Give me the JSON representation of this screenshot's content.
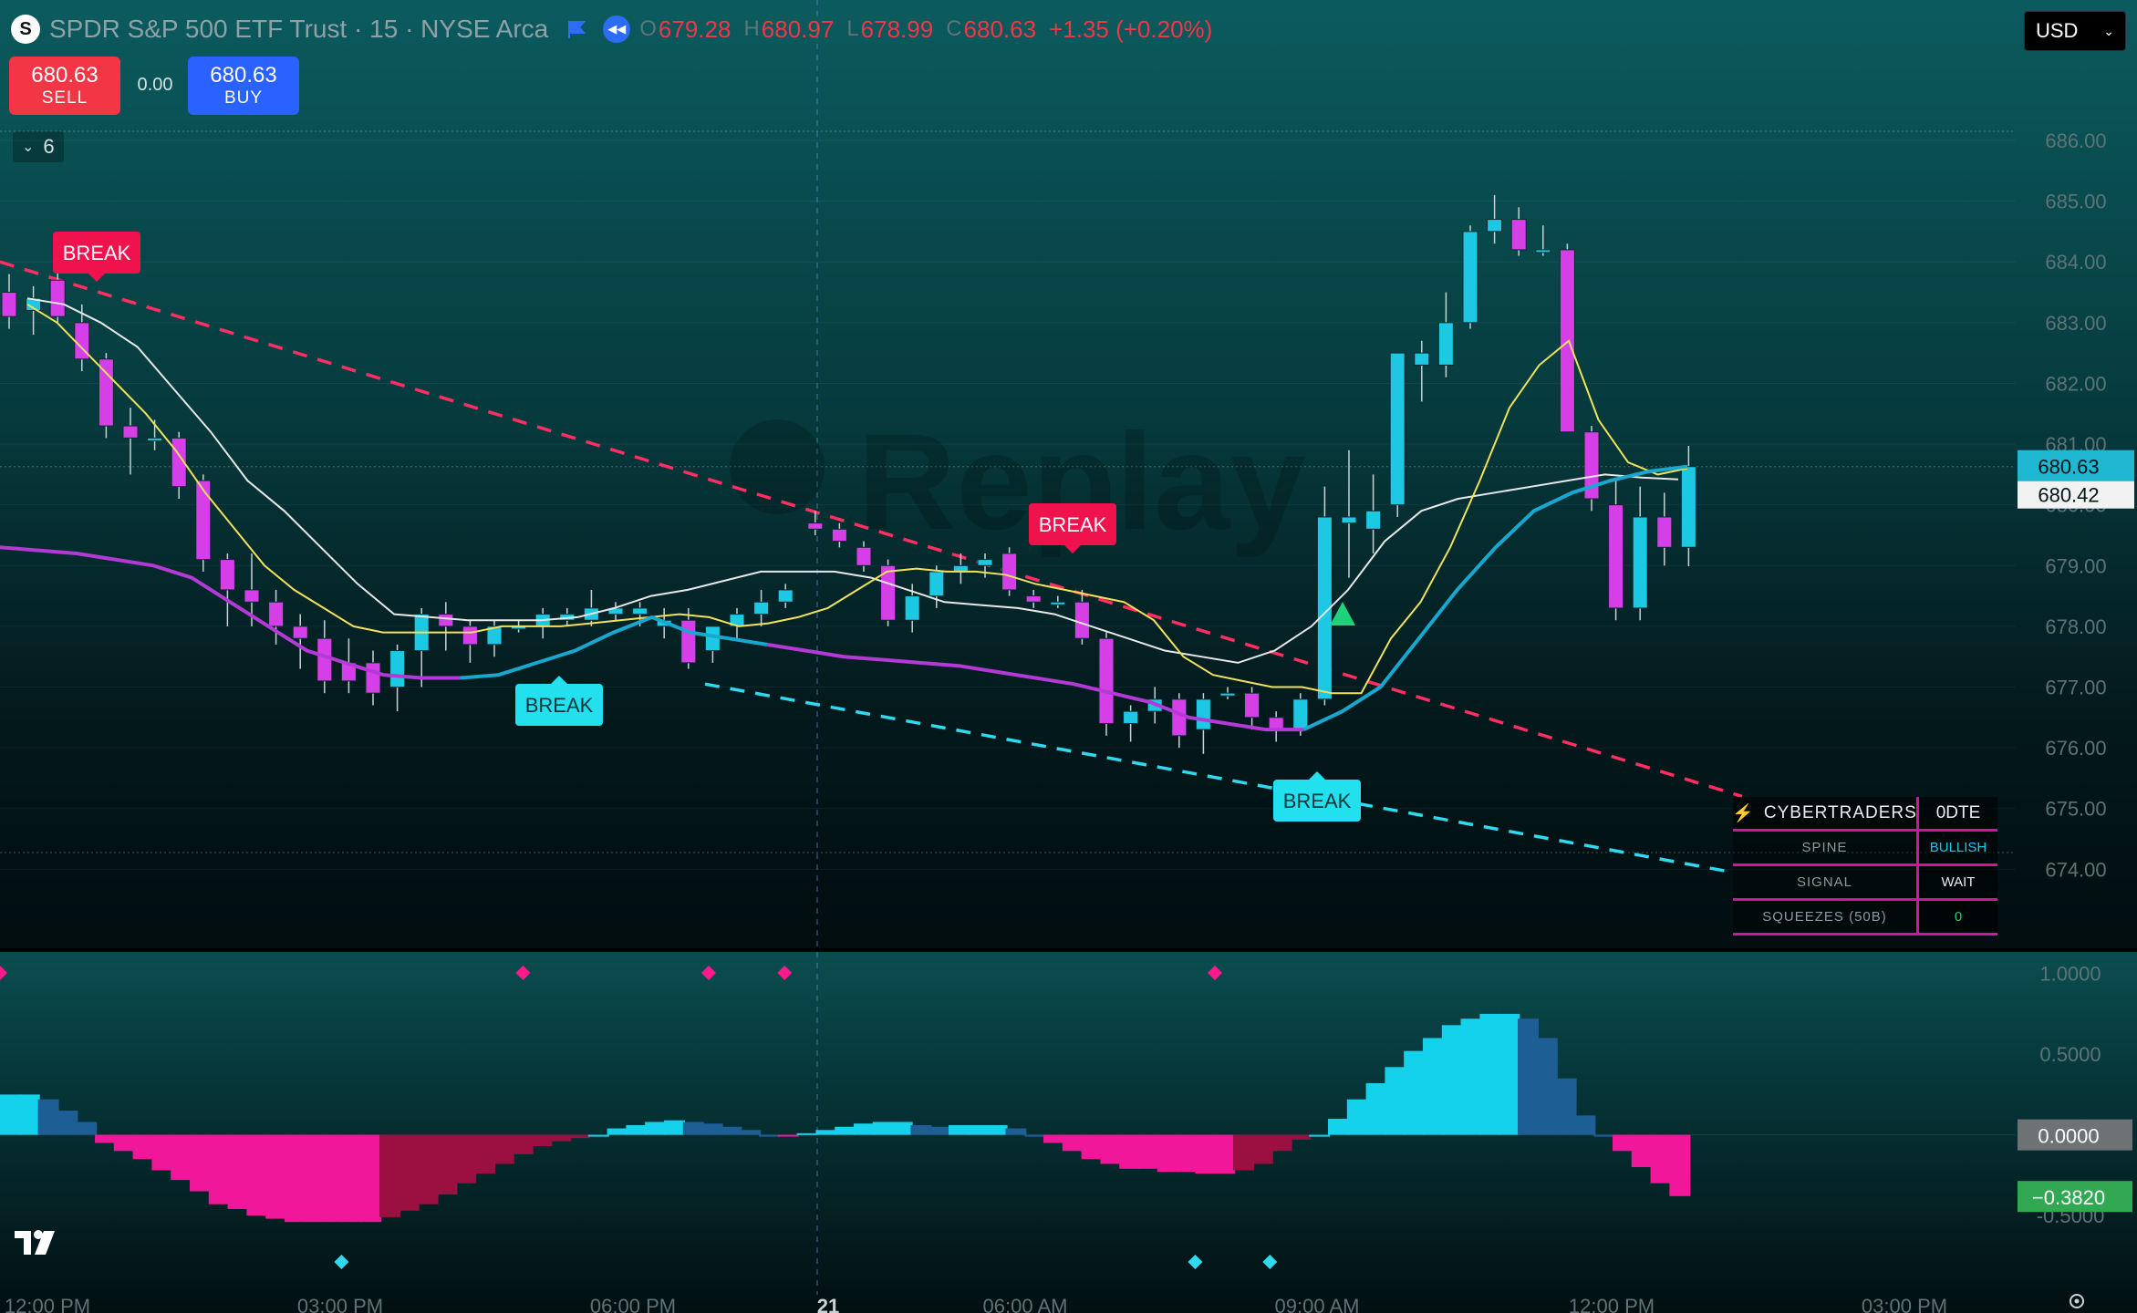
{
  "header": {
    "symbol_logo": "S",
    "name": "SPDR S&P 500 ETF Trust · 15 · NYSE Arca",
    "ohlc": [
      {
        "label": "O",
        "value": "679.28"
      },
      {
        "label": "H",
        "value": "680.97"
      },
      {
        "label": "L",
        "value": "678.99"
      },
      {
        "label": "C",
        "value": "680.63"
      }
    ],
    "change": "+1.35 (+0.20%)"
  },
  "trade": {
    "sell_price": "680.63",
    "sell_label": "SELL",
    "spread": "0.00",
    "buy_price": "680.63",
    "buy_label": "BUY"
  },
  "indicators_collapse": {
    "count": "6"
  },
  "currency": "USD",
  "watermark": "Replay",
  "colors": {
    "bull": "#1cc8e2",
    "bear": "#d63fe8",
    "fast_ma": "#f0e25a",
    "slow_ma": "#e8e8e8",
    "spine_up": "#18a8cf",
    "spine_down": "#b43ad6",
    "resistance": "#ff2e63",
    "support": "#2fd9ef",
    "hist_bull": "#14d2ec",
    "hist_bull_fade": "#1d5f94",
    "hist_bear": "#f0179b",
    "hist_bear_fade": "#9b1040"
  },
  "price_axis": {
    "ticks": [
      "686.00",
      "685.00",
      "684.00",
      "683.00",
      "682.00",
      "681.00",
      "680.00",
      "679.00",
      "678.00",
      "677.00",
      "676.00",
      "675.00",
      "674.00"
    ],
    "last_price": "680.63",
    "slow_ma_value": "680.42"
  },
  "osc_axis": {
    "ticks": [
      "1.0000",
      "0.5000",
      "0.0000",
      "-0.5000"
    ],
    "zero_label": "0.0000",
    "current_label": "−0.3820"
  },
  "time_axis": [
    "12:00 PM",
    "03:00 PM",
    "06:00 PM",
    "21",
    "06:00 AM",
    "09:00 AM",
    "12:00 PM",
    "03:00 PM"
  ],
  "labels": {
    "break": "BREAK"
  },
  "cybertraders": {
    "title": "CYBERTRADERS",
    "title_icon": "lightning-icon",
    "mode": "0DTE",
    "rows": [
      {
        "label": "SPINE",
        "value": "BULLISH"
      },
      {
        "label": "SIGNAL",
        "value": "WAIT"
      },
      {
        "label": "SQUEEZES (50B)",
        "value": "0"
      }
    ]
  },
  "chart_data": {
    "type": "candlestick",
    "symbol": "SPY",
    "interval": "15",
    "ylim": [
      673.6,
      686.3
    ],
    "candles": [
      {
        "o": 683.5,
        "h": 683.8,
        "l": 682.9,
        "c": 683.1
      },
      {
        "o": 683.2,
        "h": 683.6,
        "l": 682.8,
        "c": 683.4
      },
      {
        "o": 683.7,
        "h": 683.9,
        "l": 683.0,
        "c": 683.1
      },
      {
        "o": 683.0,
        "h": 683.3,
        "l": 682.2,
        "c": 682.4
      },
      {
        "o": 682.4,
        "h": 682.5,
        "l": 681.1,
        "c": 681.3
      },
      {
        "o": 681.3,
        "h": 681.6,
        "l": 680.5,
        "c": 681.1
      },
      {
        "o": 681.1,
        "h": 681.4,
        "l": 680.9,
        "c": 681.1
      },
      {
        "o": 681.1,
        "h": 681.2,
        "l": 680.1,
        "c": 680.3
      },
      {
        "o": 680.4,
        "h": 680.5,
        "l": 678.9,
        "c": 679.1
      },
      {
        "o": 679.1,
        "h": 679.2,
        "l": 678.0,
        "c": 678.6
      },
      {
        "o": 678.6,
        "h": 679.2,
        "l": 678.0,
        "c": 678.4
      },
      {
        "o": 678.4,
        "h": 678.6,
        "l": 677.7,
        "c": 678.0
      },
      {
        "o": 678.0,
        "h": 678.2,
        "l": 677.3,
        "c": 677.8
      },
      {
        "o": 677.8,
        "h": 678.1,
        "l": 676.9,
        "c": 677.1
      },
      {
        "o": 677.4,
        "h": 677.8,
        "l": 676.9,
        "c": 677.1
      },
      {
        "o": 677.4,
        "h": 677.6,
        "l": 676.7,
        "c": 676.9
      },
      {
        "o": 677.0,
        "h": 677.7,
        "l": 676.6,
        "c": 677.6
      },
      {
        "o": 677.6,
        "h": 678.3,
        "l": 677.0,
        "c": 678.2
      },
      {
        "o": 678.2,
        "h": 678.4,
        "l": 677.6,
        "c": 678.0
      },
      {
        "o": 678.0,
        "h": 678.1,
        "l": 677.4,
        "c": 677.7
      },
      {
        "o": 677.7,
        "h": 678.1,
        "l": 677.5,
        "c": 678.0
      },
      {
        "o": 678.0,
        "h": 678.1,
        "l": 677.9,
        "c": 678.0
      },
      {
        "o": 678.0,
        "h": 678.3,
        "l": 677.8,
        "c": 678.2
      },
      {
        "o": 678.1,
        "h": 678.3,
        "l": 678.0,
        "c": 678.2
      },
      {
        "o": 678.1,
        "h": 678.6,
        "l": 678.0,
        "c": 678.3
      },
      {
        "o": 678.2,
        "h": 678.4,
        "l": 678.1,
        "c": 678.3
      },
      {
        "o": 678.2,
        "h": 678.4,
        "l": 678.0,
        "c": 678.3
      },
      {
        "o": 678.0,
        "h": 678.3,
        "l": 677.8,
        "c": 678.1
      },
      {
        "o": 678.1,
        "h": 678.3,
        "l": 677.3,
        "c": 677.4
      },
      {
        "o": 677.6,
        "h": 678.0,
        "l": 677.4,
        "c": 678.0
      },
      {
        "o": 678.0,
        "h": 678.3,
        "l": 677.8,
        "c": 678.2
      },
      {
        "o": 678.2,
        "h": 678.6,
        "l": 678.0,
        "c": 678.4
      },
      {
        "o": 678.4,
        "h": 678.7,
        "l": 678.3,
        "c": 678.6
      },
      {
        "o": 679.7,
        "h": 679.9,
        "l": 679.5,
        "c": 679.6
      },
      {
        "o": 679.6,
        "h": 679.7,
        "l": 679.3,
        "c": 679.4
      },
      {
        "o": 679.3,
        "h": 679.4,
        "l": 678.9,
        "c": 679.0
      },
      {
        "o": 679.0,
        "h": 679.1,
        "l": 678.0,
        "c": 678.1
      },
      {
        "o": 678.1,
        "h": 678.7,
        "l": 677.9,
        "c": 678.5
      },
      {
        "o": 678.5,
        "h": 679.0,
        "l": 678.3,
        "c": 678.9
      },
      {
        "o": 678.9,
        "h": 679.2,
        "l": 678.7,
        "c": 679.0
      },
      {
        "o": 679.0,
        "h": 679.2,
        "l": 678.8,
        "c": 679.1
      },
      {
        "o": 679.2,
        "h": 679.3,
        "l": 678.5,
        "c": 678.6
      },
      {
        "o": 678.5,
        "h": 678.6,
        "l": 678.3,
        "c": 678.4
      },
      {
        "o": 678.4,
        "h": 678.5,
        "l": 678.3,
        "c": 678.4
      },
      {
        "o": 678.4,
        "h": 678.6,
        "l": 677.7,
        "c": 677.8
      },
      {
        "o": 677.8,
        "h": 677.9,
        "l": 676.2,
        "c": 676.4
      },
      {
        "o": 676.4,
        "h": 676.7,
        "l": 676.1,
        "c": 676.6
      },
      {
        "o": 676.6,
        "h": 677.0,
        "l": 676.4,
        "c": 676.8
      },
      {
        "o": 676.8,
        "h": 676.9,
        "l": 676.0,
        "c": 676.2
      },
      {
        "o": 676.3,
        "h": 676.9,
        "l": 675.9,
        "c": 676.8
      },
      {
        "o": 676.9,
        "h": 677.0,
        "l": 676.8,
        "c": 676.9
      },
      {
        "o": 676.9,
        "h": 677.0,
        "l": 676.3,
        "c": 676.5
      },
      {
        "o": 676.5,
        "h": 676.6,
        "l": 676.1,
        "c": 676.3
      },
      {
        "o": 676.3,
        "h": 676.9,
        "l": 676.2,
        "c": 676.8
      },
      {
        "o": 676.8,
        "h": 680.3,
        "l": 676.7,
        "c": 679.8
      },
      {
        "o": 679.7,
        "h": 680.9,
        "l": 678.8,
        "c": 679.8
      },
      {
        "o": 679.6,
        "h": 680.5,
        "l": 679.2,
        "c": 679.9
      },
      {
        "o": 680.0,
        "h": 682.5,
        "l": 679.8,
        "c": 682.5
      },
      {
        "o": 682.3,
        "h": 682.7,
        "l": 681.7,
        "c": 682.5
      },
      {
        "o": 682.3,
        "h": 683.5,
        "l": 682.1,
        "c": 683.0
      },
      {
        "o": 683.0,
        "h": 684.6,
        "l": 682.9,
        "c": 684.5
      },
      {
        "o": 684.5,
        "h": 685.1,
        "l": 684.3,
        "c": 684.7
      },
      {
        "o": 684.7,
        "h": 684.9,
        "l": 684.1,
        "c": 684.2
      },
      {
        "o": 684.2,
        "h": 684.6,
        "l": 684.1,
        "c": 684.2
      },
      {
        "o": 684.2,
        "h": 684.3,
        "l": 681.2,
        "c": 681.2
      },
      {
        "o": 681.2,
        "h": 681.3,
        "l": 679.9,
        "c": 680.1
      },
      {
        "o": 680.0,
        "h": 680.4,
        "l": 678.1,
        "c": 678.3
      },
      {
        "o": 678.3,
        "h": 680.3,
        "l": 678.1,
        "c": 679.8
      },
      {
        "o": 679.8,
        "h": 680.2,
        "l": 679.0,
        "c": 679.3
      },
      {
        "o": 679.3,
        "h": 680.97,
        "l": 678.99,
        "c": 680.63
      }
    ],
    "fast_ma": [
      683.3,
      683.0,
      682.5,
      682.0,
      681.5,
      680.9,
      680.2,
      679.6,
      679.0,
      678.6,
      678.3,
      678.0,
      677.9,
      677.9,
      677.9,
      677.9,
      678.0,
      678.0,
      678.0,
      678.05,
      678.1,
      678.15,
      678.2,
      678.15,
      678.0,
      678.05,
      678.15,
      678.3,
      678.6,
      678.9,
      678.95,
      678.9,
      678.9,
      678.85,
      678.7,
      678.6,
      678.5,
      678.4,
      678.1,
      677.5,
      677.2,
      677.1,
      677.0,
      677.0,
      676.9,
      676.9,
      677.8,
      678.4,
      679.3,
      680.4,
      681.6,
      682.3,
      682.7,
      681.4,
      680.7,
      680.5,
      680.6
    ],
    "slow_ma": [
      683.4,
      683.3,
      683.0,
      682.6,
      681.9,
      681.2,
      680.4,
      679.9,
      679.3,
      678.7,
      678.2,
      678.15,
      678.1,
      678.1,
      678.1,
      678.15,
      678.3,
      678.5,
      678.6,
      678.75,
      678.9,
      678.9,
      678.9,
      678.8,
      678.6,
      678.4,
      678.35,
      678.3,
      678.2,
      678.0,
      677.8,
      677.6,
      677.5,
      677.4,
      677.6,
      678.0,
      678.6,
      679.4,
      679.9,
      680.1,
      680.2,
      680.3,
      680.4,
      680.5,
      680.45,
      680.42
    ],
    "spine": [
      679.3,
      679.25,
      679.2,
      679.1,
      679.0,
      678.8,
      678.4,
      678.0,
      677.6,
      677.4,
      677.2,
      677.15,
      677.15,
      677.2,
      677.4,
      677.6,
      677.9,
      678.15,
      677.9,
      677.8,
      677.7,
      677.6,
      677.5,
      677.45,
      677.4,
      677.35,
      677.25,
      677.15,
      677.05,
      676.9,
      676.75,
      676.5,
      676.4,
      676.3,
      676.3,
      676.6,
      677.0,
      677.8,
      678.6,
      679.3,
      679.9,
      680.2,
      680.4,
      680.55,
      680.63
    ],
    "resistance_line": [
      [
        684.0,
        0
      ],
      [
        675.2,
        1
      ]
    ],
    "support_line": [
      [
        677.2,
        0
      ],
      [
        674.4,
        1
      ]
    ],
    "oscillator": {
      "ylim": [
        -0.85,
        1.1
      ],
      "values": [
        0.25,
        0.25,
        0.22,
        0.15,
        0.08,
        -0.05,
        -0.1,
        -0.15,
        -0.22,
        -0.28,
        -0.35,
        -0.43,
        -0.46,
        -0.5,
        -0.52,
        -0.54,
        -0.54,
        -0.54,
        -0.54,
        -0.54,
        -0.51,
        -0.47,
        -0.43,
        -0.37,
        -0.3,
        -0.24,
        -0.18,
        -0.12,
        -0.07,
        -0.04,
        -0.02,
        0.0,
        0.04,
        0.06,
        0.08,
        0.09,
        0.08,
        0.07,
        0.05,
        0.03,
        0.0,
        -0.01,
        0.01,
        0.03,
        0.05,
        0.07,
        0.08,
        0.08,
        0.06,
        0.05,
        0.06,
        0.06,
        0.06,
        0.04,
        0.0,
        -0.05,
        -0.1,
        -0.15,
        -0.18,
        -0.21,
        -0.21,
        -0.23,
        -0.23,
        -0.24,
        -0.24,
        -0.22,
        -0.18,
        -0.1,
        -0.03,
        0.0,
        0.1,
        0.22,
        0.32,
        0.42,
        0.52,
        0.6,
        0.68,
        0.72,
        0.75,
        0.75,
        0.72,
        0.6,
        0.35,
        0.12,
        0.0,
        -0.1,
        -0.2,
        -0.3,
        -0.38
      ],
      "pink_markers": [
        0.0,
        0.31,
        0.42,
        0.465,
        0.72
      ],
      "cyan_markers": [
        0.16,
        0.56,
        0.595
      ]
    }
  }
}
